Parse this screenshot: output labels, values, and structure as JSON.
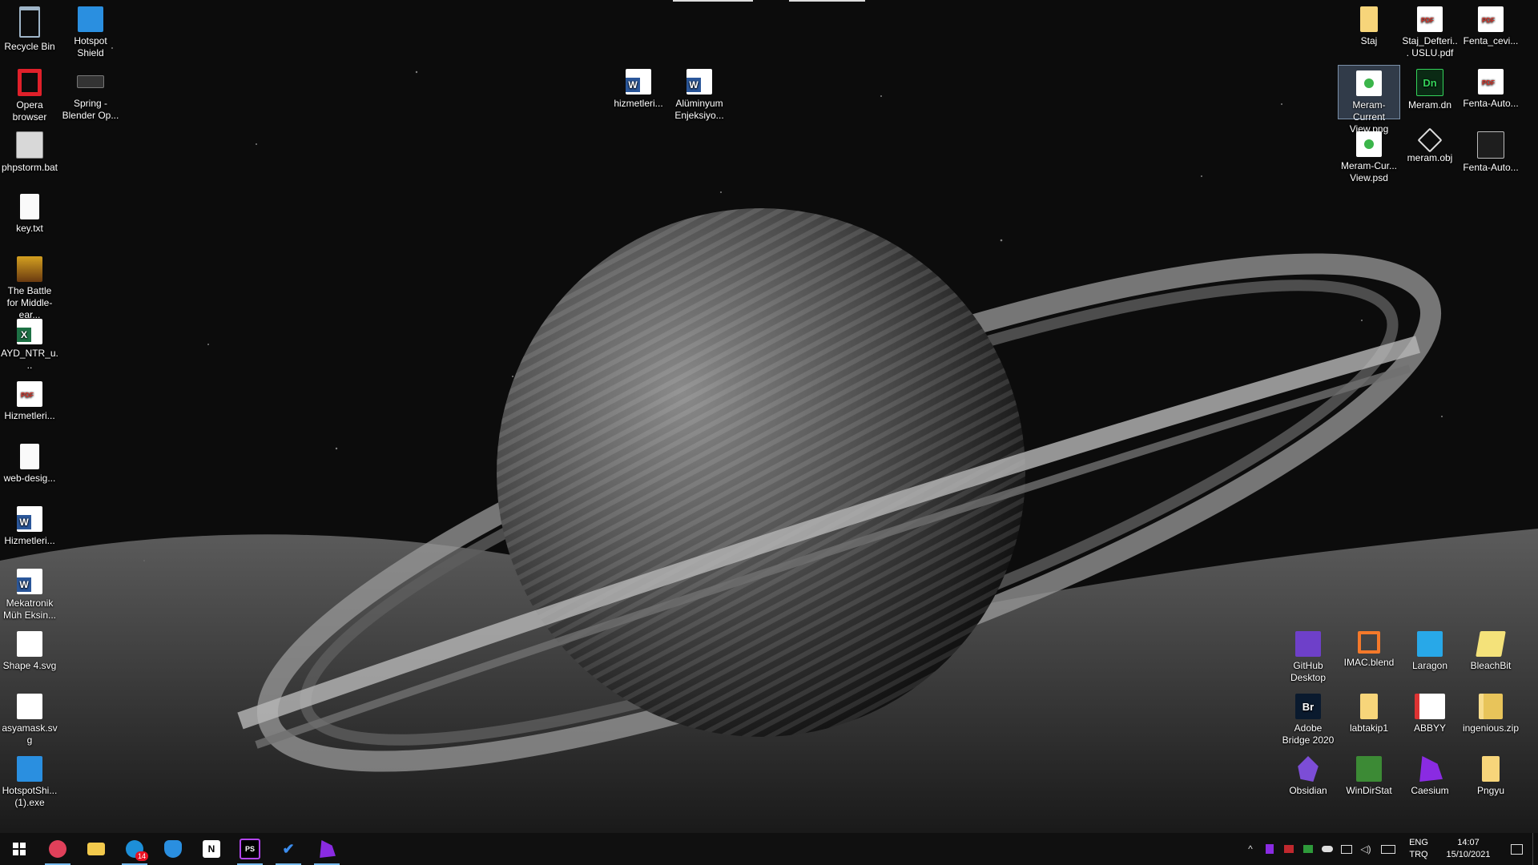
{
  "desktop": {
    "left_column": [
      {
        "label": "Recycle Bin",
        "icon": "recycle-bin-icon"
      },
      {
        "label": "Opera browser",
        "icon": "opera-icon"
      },
      {
        "label": "phpstorm.bat",
        "icon": "batch-file-icon"
      },
      {
        "label": "key.txt",
        "icon": "text-file-icon"
      },
      {
        "label": "The Battle for Middle-ear...",
        "icon": "game-icon"
      },
      {
        "label": "AYD_NTR_u...",
        "icon": "excel-icon"
      },
      {
        "label": "Hizmetleri...",
        "icon": "pdf-icon"
      },
      {
        "label": "web-desig...",
        "icon": "text-file-icon"
      },
      {
        "label": "Hizmetleri...",
        "icon": "word-icon"
      },
      {
        "label": "Mekatronik Müh Eksin...",
        "icon": "word-icon"
      },
      {
        "label": "Shape 4.svg",
        "icon": "svg-file-icon"
      },
      {
        "label": "asyamask.svg",
        "icon": "svg-file-icon"
      },
      {
        "label": "HotspotShi... (1).exe",
        "icon": "hotspot-shield-icon"
      }
    ],
    "second_column": [
      {
        "label": "Hotspot Shield",
        "icon": "hotspot-shield-icon"
      },
      {
        "label": "Spring - Blender Op...",
        "icon": "blender-file-icon"
      }
    ],
    "center_icons": [
      {
        "label": "hizmetleri...",
        "icon": "word-icon"
      },
      {
        "label": "Alüminyum Enjeksiyo...",
        "icon": "word-icon"
      }
    ],
    "top_right": [
      {
        "label": "Staj",
        "icon": "folder-icon"
      },
      {
        "label": "Staj_Defteri... USLU.pdf",
        "icon": "pdf-icon"
      },
      {
        "label": "Fenta_cevi...",
        "icon": "pdf-icon"
      },
      {
        "label": "Meram-Current View.png",
        "icon": "image-file-icon",
        "selected": true
      },
      {
        "label": "Meram.dn",
        "icon": "dimension-icon"
      },
      {
        "label": "Fenta-Auto...",
        "icon": "pdf-icon"
      },
      {
        "label": "Meram-Cur... View.psd",
        "icon": "image-file-icon"
      },
      {
        "label": "meram.obj",
        "icon": "3d-object-icon"
      },
      {
        "label": "Fenta-Auto...",
        "icon": "document-icon"
      }
    ],
    "bottom_right": [
      {
        "label": "GitHub Desktop",
        "icon": "github-icon"
      },
      {
        "label": "IMAC.blend",
        "icon": "blender-icon"
      },
      {
        "label": "Laragon",
        "icon": "laragon-icon"
      },
      {
        "label": "BleachBit",
        "icon": "bleachbit-icon"
      },
      {
        "label": "Adobe Bridge 2020",
        "icon": "adobe-bridge-icon",
        "glyph": "Br"
      },
      {
        "label": "labtakip1",
        "icon": "folder-icon"
      },
      {
        "label": "ABBYY",
        "icon": "abbyy-icon"
      },
      {
        "label": "ingenious.zip",
        "icon": "zip-icon"
      },
      {
        "label": "Obsidian",
        "icon": "obsidian-icon"
      },
      {
        "label": "WinDirStat",
        "icon": "windirstat-icon"
      },
      {
        "label": "Caesium",
        "icon": "caesium-icon"
      },
      {
        "label": "Pngyu",
        "icon": "folder-icon"
      }
    ]
  },
  "taskbar": {
    "apps": [
      {
        "name": "start-button",
        "glyph": "",
        "open": false
      },
      {
        "name": "taskbar-app-photo",
        "glyph": "",
        "open": true
      },
      {
        "name": "taskbar-app-file-explorer",
        "glyph": "",
        "open": false
      },
      {
        "name": "taskbar-app-edge",
        "glyph": "",
        "open": true,
        "badge": "14"
      },
      {
        "name": "taskbar-app-hotspot-shield",
        "glyph": "",
        "open": false
      },
      {
        "name": "taskbar-app-notion",
        "glyph": "N",
        "open": false
      },
      {
        "name": "taskbar-app-phpstorm",
        "glyph": "PS",
        "open": true
      },
      {
        "name": "taskbar-app-todo",
        "glyph": "✔",
        "open": true
      },
      {
        "name": "taskbar-app-caesium",
        "glyph": "",
        "open": true
      }
    ],
    "tray": {
      "lang_line1": "ENG",
      "lang_line2": "TRQ",
      "time": "14:07",
      "date": "15/10/2021"
    }
  },
  "colors": {
    "taskbar": "#101010",
    "accent": "#76b9ed",
    "badge": "#e81123"
  }
}
